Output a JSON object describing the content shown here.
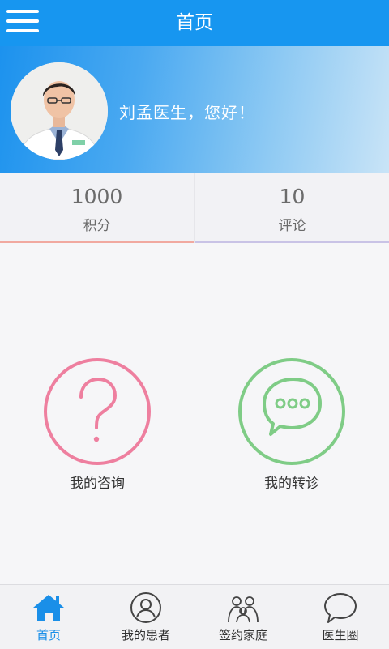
{
  "header": {
    "title": "首页",
    "menu_icon": "menu-icon"
  },
  "profile": {
    "greeting": "刘孟医生，您好！",
    "avatar_icon": "doctor-avatar"
  },
  "stats": [
    {
      "value": "1000",
      "label": "积分"
    },
    {
      "value": "10",
      "label": "评论"
    }
  ],
  "actions": [
    {
      "label": "我的咨询",
      "icon": "question-icon",
      "color": "#ee7f9f"
    },
    {
      "label": "我的转诊",
      "icon": "chat-bubble-icon",
      "color": "#7fcc86"
    }
  ],
  "tabs": [
    {
      "label": "首页",
      "icon": "home-icon",
      "active": true
    },
    {
      "label": "我的患者",
      "icon": "patient-icon",
      "active": false
    },
    {
      "label": "签约家庭",
      "icon": "family-icon",
      "active": false
    },
    {
      "label": "医生圈",
      "icon": "speech-bubble-icon",
      "active": false
    }
  ],
  "colors": {
    "primary": "#1796f0",
    "tab_active": "#1a8fe8"
  }
}
